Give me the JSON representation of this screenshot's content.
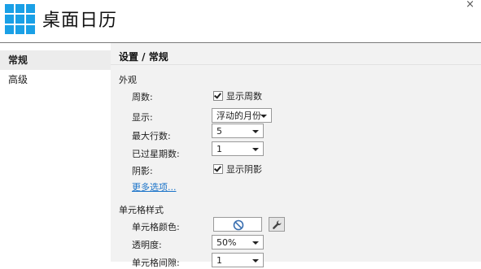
{
  "app": {
    "title": "桌面日历",
    "close": "×"
  },
  "sidebar": {
    "items": [
      {
        "label": "常规"
      },
      {
        "label": "高级"
      }
    ]
  },
  "main": {
    "title": "设置 / 常规",
    "appearance": {
      "heading": "外观",
      "week_number": {
        "label": "周数:",
        "checkbox_text": "显示周数",
        "checked": true
      },
      "display": {
        "label": "显示:",
        "value": "浮动的月份"
      },
      "max_rows": {
        "label": "最大行数:",
        "value": "5"
      },
      "past_weeks": {
        "label": "已过星期数:",
        "value": "1"
      },
      "shadow": {
        "label": "阴影:",
        "checkbox_text": "显示阴影",
        "checked": true
      },
      "more_options": "更多选项..."
    },
    "cell_style": {
      "heading": "单元格样式",
      "cell_color": {
        "label": "单元格颜色:",
        "icon": "no-color-icon"
      },
      "opacity": {
        "label": "透明度:",
        "value": "50%"
      },
      "cell_spacing": {
        "label": "单元格间隙:",
        "value": "1"
      }
    }
  },
  "colors": {
    "accent": "#1aa0e6",
    "link": "#1a73c9",
    "panel": "#f2f2f2"
  }
}
